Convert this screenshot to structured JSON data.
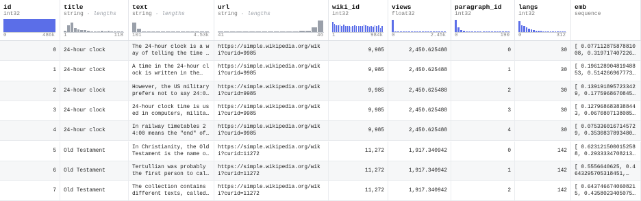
{
  "colors": {
    "hist_blue": "#5b6ee8",
    "hist_gray": "#9aa0aa"
  },
  "columns": [
    {
      "key": "id",
      "name": "id",
      "type": "int32",
      "type_sub": "",
      "kind": "num",
      "color": "blue",
      "hist": [
        1,
        1,
        1,
        1,
        1,
        1,
        1,
        1,
        1,
        1,
        1,
        1,
        1,
        1,
        1,
        1,
        1,
        1,
        1,
        1,
        1,
        1,
        1,
        1,
        1,
        1,
        1,
        1,
        1,
        1,
        1,
        1,
        1,
        1,
        1,
        1,
        1,
        1,
        1,
        1,
        1,
        1,
        1,
        1,
        1,
        1,
        1,
        1,
        1,
        1,
        1,
        1,
        1,
        1,
        1,
        1,
        1,
        1,
        1,
        1,
        1,
        1,
        1,
        1,
        1,
        1,
        1,
        1,
        1,
        1,
        1,
        1,
        1,
        1,
        1,
        1
      ],
      "min_label": "0",
      "max_label": "486k"
    },
    {
      "key": "title",
      "name": "title",
      "type": "string",
      "type_sub": "lengths",
      "kind": "text",
      "color": "gray",
      "hist": [
        0.08,
        0.55,
        0.75,
        0.3,
        0.2,
        0.18,
        0.15,
        0.08,
        0.06,
        0.05,
        0.05,
        0.08,
        0.06,
        0.1,
        0.05,
        0.04,
        0.04,
        0.03
      ],
      "min_label": "1",
      "max_label": "118"
    },
    {
      "key": "text",
      "name": "text",
      "type": "string",
      "type_sub": "lengths",
      "kind": "text",
      "color": "gray",
      "hist": [
        0.75,
        0.25,
        0.05,
        0.03,
        0.03,
        0.03,
        0.02,
        0.02,
        0.02,
        0.02,
        0.02,
        0.02,
        0.02,
        0.02,
        0.02,
        0.02
      ],
      "min_label": "101",
      "max_label": "4.53k"
    },
    {
      "key": "url",
      "name": "url",
      "type": "string",
      "type_sub": "lengths",
      "kind": "text",
      "color": "gray",
      "hist": [
        0.05,
        0.05,
        0.05,
        0.05,
        0.05,
        0.05,
        0.05,
        0.05,
        0.05,
        0.05,
        0.06,
        0.06,
        0.07,
        0.08,
        0.1,
        0.35,
        0.9
      ],
      "min_label": "41",
      "max_label": "46"
    },
    {
      "key": "wiki_id",
      "name": "wiki_id",
      "type": "int32",
      "type_sub": "",
      "kind": "num",
      "color": "blue",
      "hist": [
        0.8,
        0.65,
        0.55,
        0.55,
        0.6,
        0.5,
        0.6,
        0.45,
        0.5,
        0.5,
        0.4,
        0.5,
        0.55,
        0.45,
        0.5,
        0.45,
        0.45,
        0.6,
        0.55,
        0.5,
        0.4,
        0.5,
        0.4,
        0.55,
        0.45,
        0.55,
        0.3,
        0.45
      ],
      "min_label": "1",
      "max_label": "984k"
    },
    {
      "key": "views",
      "name": "views",
      "type": "float32",
      "type_sub": "",
      "kind": "num",
      "color": "blue",
      "hist": [
        0.95,
        0.06,
        0.03,
        0.02,
        0.02,
        0.02,
        0.02,
        0.02,
        0.02,
        0.02,
        0.02,
        0.02,
        0.02,
        0.02,
        0.02,
        0.02,
        0.02,
        0.02,
        0.02,
        0.02
      ],
      "min_label": "0",
      "max_label": "2.45k"
    },
    {
      "key": "paragraph_id",
      "name": "paragraph_id",
      "type": "int32",
      "type_sub": "",
      "kind": "num",
      "color": "blue",
      "hist": [
        0.95,
        0.35,
        0.15,
        0.08,
        0.05,
        0.04,
        0.03,
        0.02,
        0.02,
        0.02,
        0.02,
        0.02,
        0.02,
        0.02,
        0.02,
        0.02,
        0.02,
        0.02,
        0.02,
        0.02
      ],
      "min_label": "0",
      "max_label": "190"
    },
    {
      "key": "langs",
      "name": "langs",
      "type": "int32",
      "type_sub": "",
      "kind": "num",
      "color": "blue",
      "hist": [
        0.85,
        0.55,
        0.5,
        0.35,
        0.25,
        0.2,
        0.15,
        0.12,
        0.1,
        0.08,
        0.06,
        0.05,
        0.04,
        0.03,
        0.03,
        0.02,
        0.02,
        0.02,
        0.02,
        0.02
      ],
      "min_label": "0",
      "max_label": "312"
    },
    {
      "key": "emb",
      "name": "emb",
      "type": "sequence",
      "type_sub": "",
      "kind": "text",
      "color": "none",
      "hist": [],
      "min_label": "",
      "max_label": ""
    }
  ],
  "rows": [
    {
      "id": "0",
      "title": "24-hour clock",
      "text": "The 24-hour clock is a way of telling the time in…",
      "url": "https://simple.wikipedia.org/wiki?curid=9985",
      "wiki_id": "9,985",
      "views": "2,450.625488",
      "paragraph_id": "0",
      "langs": "30",
      "emb": "[ 0.07711287587881008, 0.3197174072265625,…"
    },
    {
      "id": "1",
      "title": "24-hour clock",
      "text": "A time in the 24-hour clock is written in the…",
      "url": "https://simple.wikipedia.org/wiki?curid=9985",
      "wiki_id": "9,985",
      "views": "2,450.625488",
      "paragraph_id": "1",
      "langs": "30",
      "emb": "[ 0.19612890481948853, 0.5142669677734375,…"
    },
    {
      "id": "2",
      "title": "24-hour clock",
      "text": "However, the US military prefers not to say 24:00 …",
      "url": "https://simple.wikipedia.org/wiki?curid=9985",
      "wiki_id": "9,985",
      "views": "2,450.625488",
      "paragraph_id": "2",
      "langs": "30",
      "emb": "[ 0.1391918957233429, 0.17759686708450317,…"
    },
    {
      "id": "3",
      "title": "24-hour clock",
      "text": "24-hour clock time is used in computers, military,…",
      "url": "https://simple.wikipedia.org/wiki?curid=9985",
      "wiki_id": "9,985",
      "views": "2,450.625488",
      "paragraph_id": "3",
      "langs": "30",
      "emb": "[ 0.1279686838388443, 0.0670807138085363,…"
    },
    {
      "id": "4",
      "title": "24-hour clock",
      "text": "In railway timetables 24:00 means the \"end\" of…",
      "url": "https://simple.wikipedia.org/wiki?curid=9985",
      "wiki_id": "9,985",
      "views": "2,450.625488",
      "paragraph_id": "4",
      "langs": "30",
      "emb": "[ 0.0753360167145729, 0.35308378934806213,…"
    },
    {
      "id": "5",
      "title": "Old Testament",
      "text": "In Christianity, the Old Testament is the name of…",
      "url": "https://simple.wikipedia.org/wiki?curid=11272",
      "wiki_id": "11,272",
      "views": "1,917.340942",
      "paragraph_id": "0",
      "langs": "142",
      "emb": "[ 0.6231215000152588, 0.2933334708213806,…"
    },
    {
      "id": "6",
      "title": "Old Testament",
      "text": "Tertullian was probably the first person to call…",
      "url": "https://simple.wikipedia.org/wiki?curid=11272",
      "wiki_id": "11,272",
      "views": "1,917.340942",
      "paragraph_id": "1",
      "langs": "142",
      "emb": "[ 0.5556640625, 0.4643295705318451,…"
    },
    {
      "id": "7",
      "title": "Old Testament",
      "text": "The collection contains different texts, called…",
      "url": "https://simple.wikipedia.org/wiki?curid=11272",
      "wiki_id": "11,272",
      "views": "1,917.340942",
      "paragraph_id": "2",
      "langs": "142",
      "emb": "[ 0.6437466740608215, 0.4358023405075073,…"
    }
  ]
}
